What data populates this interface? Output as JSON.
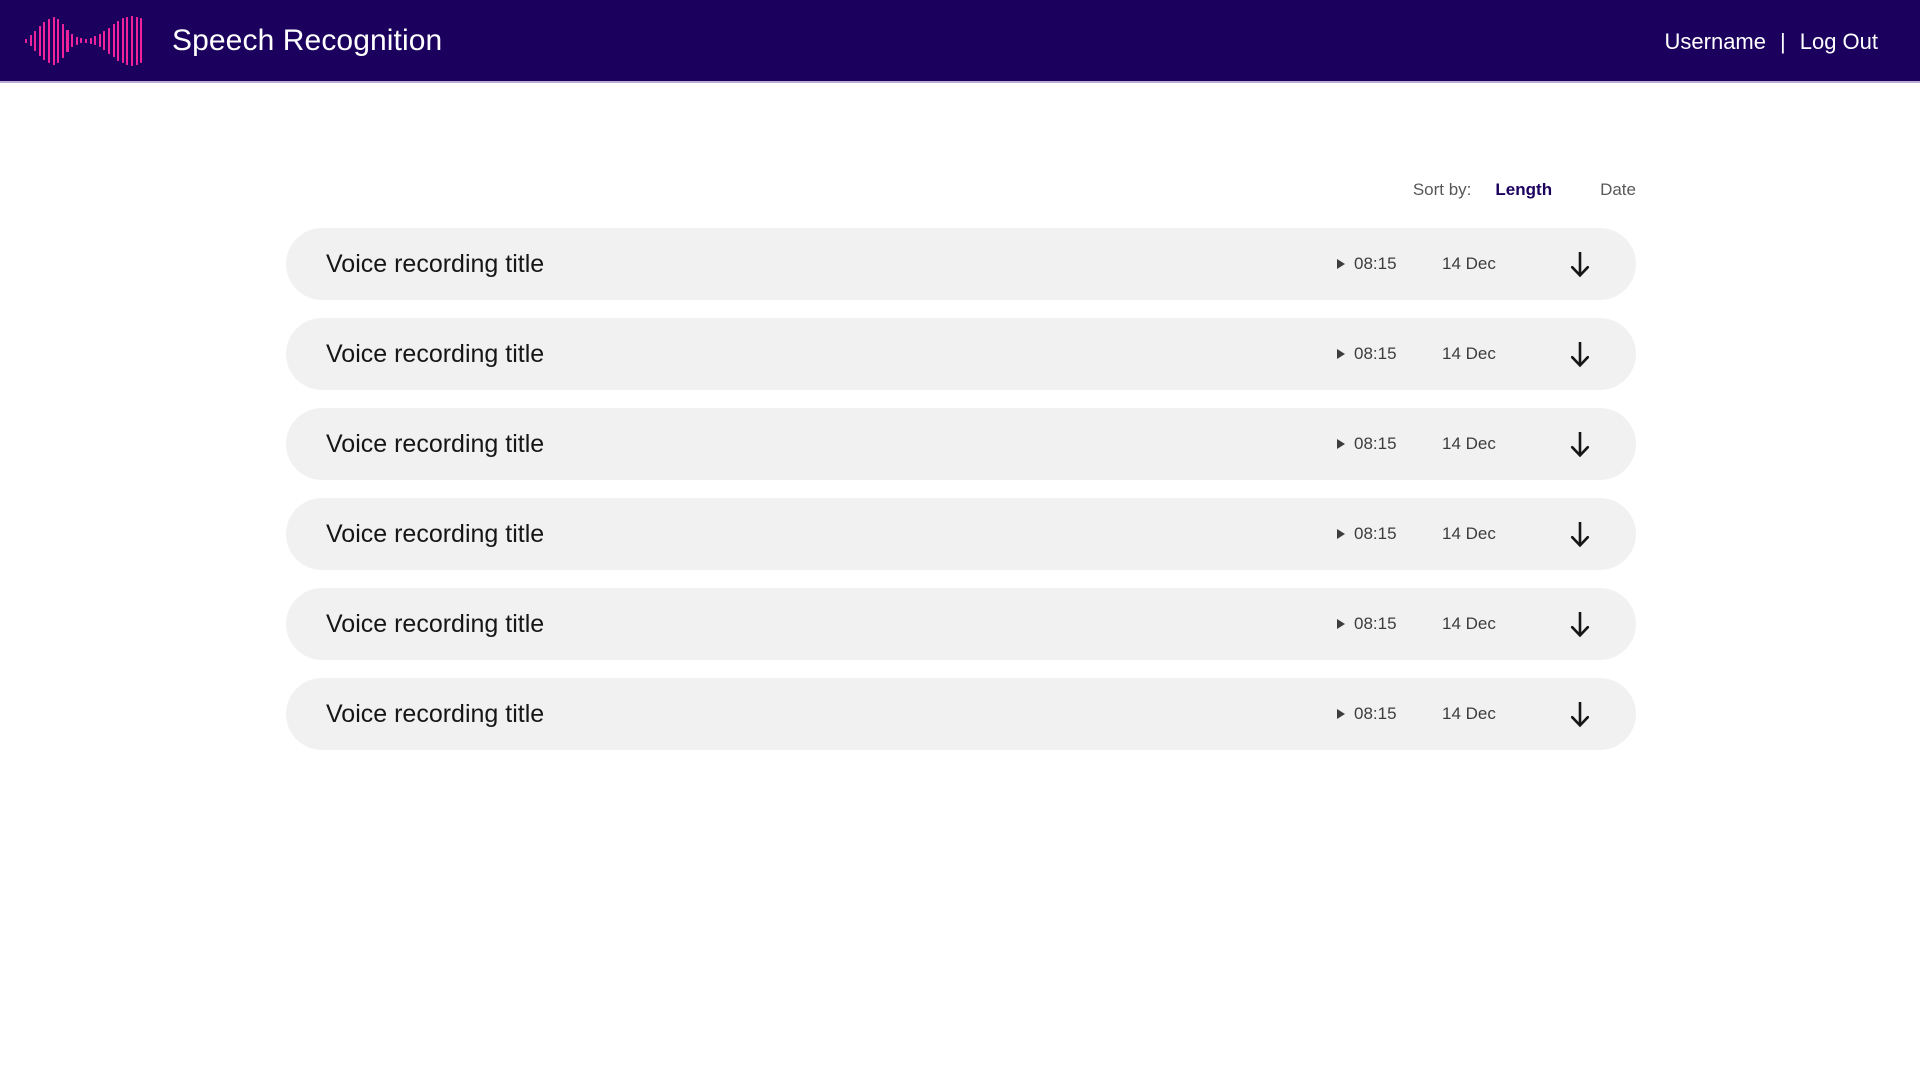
{
  "header": {
    "title": "Speech Recognition",
    "logo_icon": "waveform-icon",
    "logo_bar_heights": [
      4,
      11,
      20,
      30,
      38,
      44,
      48,
      44,
      34,
      22,
      13,
      8,
      5,
      4,
      6,
      9,
      13,
      19,
      26,
      33,
      40,
      45,
      48,
      50,
      48,
      45
    ],
    "username": "Username",
    "separator": "|",
    "logout": "Log Out",
    "background_color": "#1b005e",
    "accent_color": "#f0229c"
  },
  "sort": {
    "label": "Sort by:",
    "options": [
      {
        "label": "Length",
        "active": true
      },
      {
        "label": "Date",
        "active": false
      }
    ]
  },
  "recordings": [
    {
      "title": "Voice recording title",
      "duration": "08:15",
      "date": "14 Dec",
      "play_icon": "play-icon",
      "download_icon": "download-arrow-icon"
    },
    {
      "title": "Voice recording title",
      "duration": "08:15",
      "date": "14 Dec",
      "play_icon": "play-icon",
      "download_icon": "download-arrow-icon"
    },
    {
      "title": "Voice recording title",
      "duration": "08:15",
      "date": "14 Dec",
      "play_icon": "play-icon",
      "download_icon": "download-arrow-icon"
    },
    {
      "title": "Voice recording title",
      "duration": "08:15",
      "date": "14 Dec",
      "play_icon": "play-icon",
      "download_icon": "download-arrow-icon"
    },
    {
      "title": "Voice recording title",
      "duration": "08:15",
      "date": "14 Dec",
      "play_icon": "play-icon",
      "download_icon": "download-arrow-icon"
    },
    {
      "title": "Voice recording title",
      "duration": "08:15",
      "date": "14 Dec",
      "play_icon": "play-icon",
      "download_icon": "download-arrow-icon"
    }
  ]
}
